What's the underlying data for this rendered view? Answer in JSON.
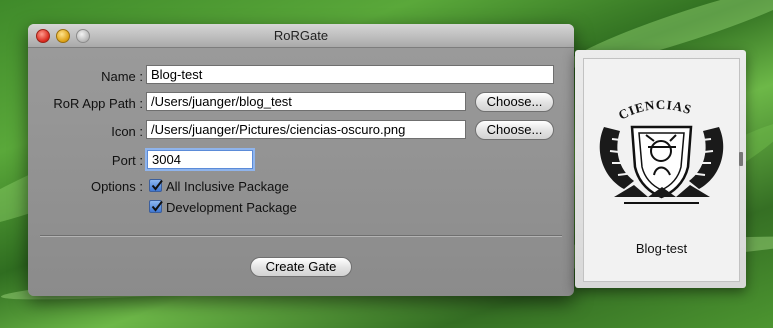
{
  "window": {
    "title": "RoRGate"
  },
  "form": {
    "name": {
      "label": "Name :",
      "value": "Blog-test"
    },
    "app_path": {
      "label": "RoR App Path :",
      "value": "/Users/juanger/blog_test",
      "button": "Choose..."
    },
    "icon": {
      "label": "Icon :",
      "value": "/Users/juanger/Pictures/ciencias-oscuro.png",
      "button": "Choose..."
    },
    "port": {
      "label": "Port :",
      "value": "3004"
    },
    "options": {
      "label": "Options :",
      "items": [
        {
          "label": "All Inclusive Package",
          "checked": true
        },
        {
          "label": "Development Package",
          "checked": true
        }
      ]
    },
    "submit_label": "Create Gate"
  },
  "preview": {
    "icon": "unam-ciencias-seal-icon",
    "seal_text": "CIENCIAS",
    "caption": "Blog-test"
  },
  "colors": {
    "accent": "#3f78d3",
    "focus_ring": "#8fb4ec"
  }
}
